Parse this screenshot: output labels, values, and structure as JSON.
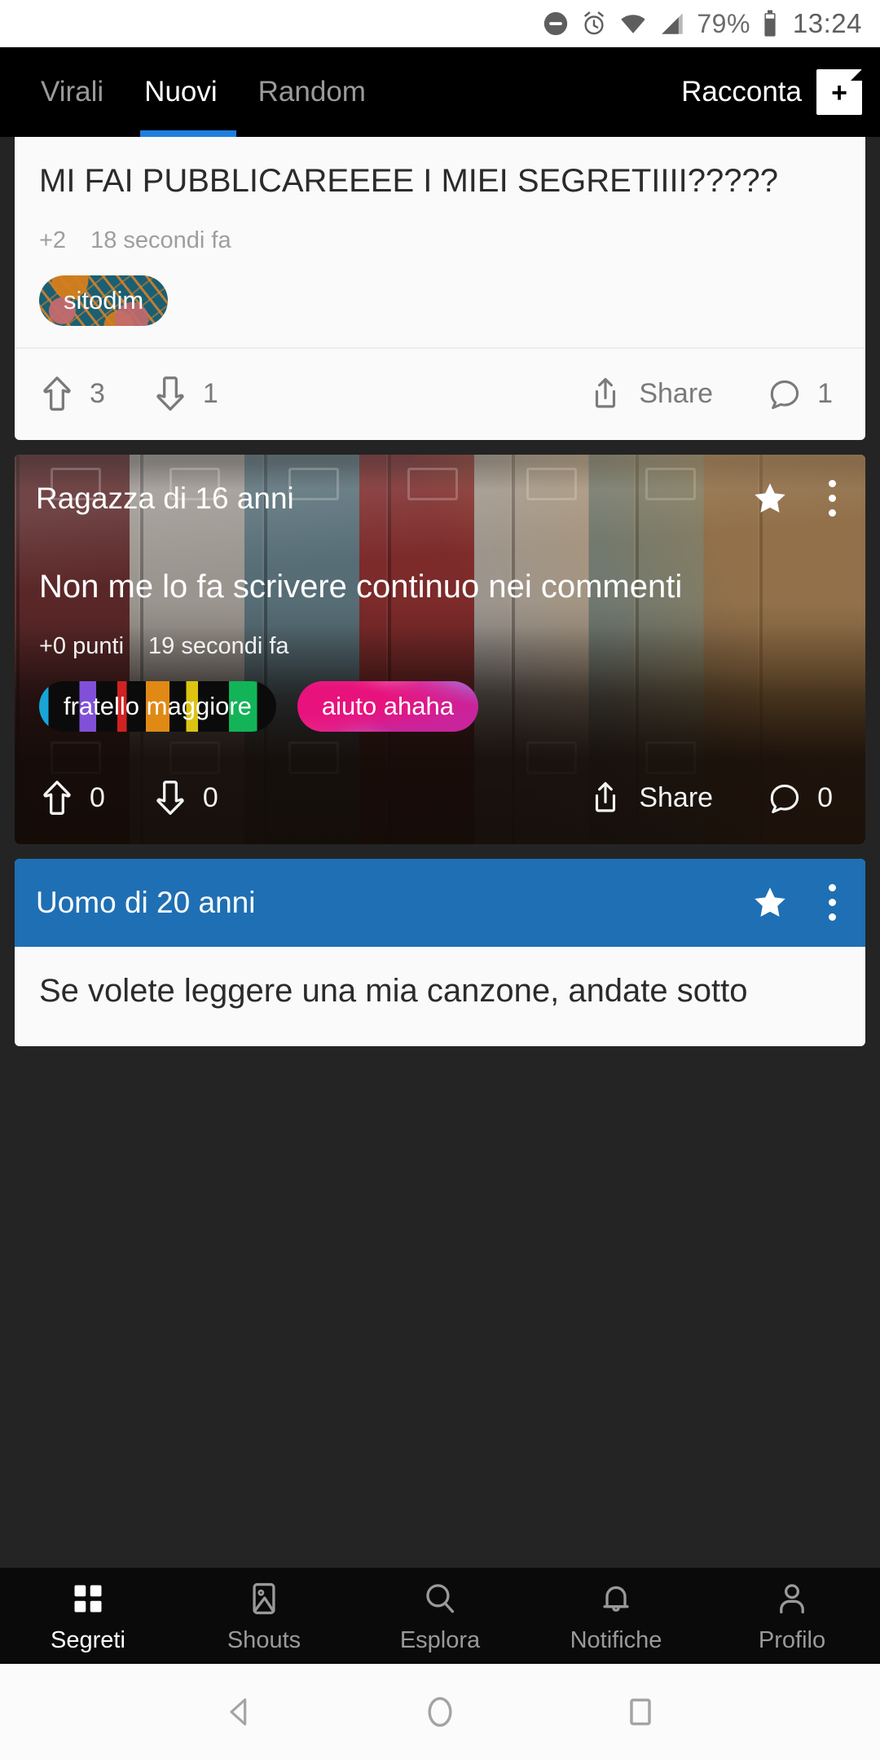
{
  "status_bar": {
    "icons": [
      "do-not-disturb-icon",
      "alarm-icon",
      "wifi-icon",
      "cellular-signal-icon",
      "battery-icon"
    ],
    "battery_percent": "79%",
    "time": "13:24"
  },
  "top_bar": {
    "tabs": [
      {
        "label": "Virali",
        "active": false
      },
      {
        "label": "Nuovi",
        "active": true
      },
      {
        "label": "Random",
        "active": false
      }
    ],
    "compose_label": "Racconta",
    "compose_icon": "add-note-icon",
    "active_underline_color": "#1f7fe0"
  },
  "posts": [
    {
      "id": "post-1",
      "author": null,
      "text": "MI FAI PUBBLICAREEEE I MIEI SEGRETIIII?????",
      "points": "+2",
      "time": "18 secondi fa",
      "tags": [
        {
          "label": "sitodim",
          "style": "sitodim"
        }
      ],
      "upvotes": "3",
      "downvotes": "1",
      "share_label": "Share",
      "comments": "1",
      "header_visible": false
    },
    {
      "id": "post-2",
      "author": "Ragazza di 16 anni",
      "text": "Non me lo fa scrivere continuo nei commenti",
      "points": "+0 punti",
      "time": "19 secondi fa",
      "tags": [
        {
          "label": "fratello maggiore",
          "style": "fratello"
        },
        {
          "label": "aiuto ahaha",
          "style": "aiuto"
        }
      ],
      "upvotes": "0",
      "downvotes": "0",
      "share_label": "Share",
      "comments": "0",
      "header_visible": true,
      "header_type": "image",
      "header_image": "lockers-photo"
    },
    {
      "id": "post-3",
      "author": "Uomo di 20 anni",
      "text": "Se volete leggere una mia canzone, andate sotto",
      "header_visible": true,
      "header_type": "color",
      "header_color": "#1f6fb4"
    }
  ],
  "post_icons": {
    "star": "star-icon",
    "menu": "more-vertical-icon",
    "upvote": "upvote-arrow-icon",
    "downvote": "downvote-arrow-icon",
    "share": "share-icon",
    "comment": "comment-bubble-icon"
  },
  "bottom_nav": [
    {
      "label": "Segreti",
      "icon": "grid-icon",
      "active": true
    },
    {
      "label": "Shouts",
      "icon": "image-icon",
      "active": false
    },
    {
      "label": "Esplora",
      "icon": "search-icon",
      "active": false
    },
    {
      "label": "Notifiche",
      "icon": "bell-icon",
      "active": false
    },
    {
      "label": "Profilo",
      "icon": "person-icon",
      "active": false
    }
  ],
  "soft_keys": [
    {
      "name": "back",
      "icon": "triangle-back-icon"
    },
    {
      "name": "home",
      "icon": "circle-home-icon"
    },
    {
      "name": "recents",
      "icon": "square-recents-icon"
    }
  ]
}
